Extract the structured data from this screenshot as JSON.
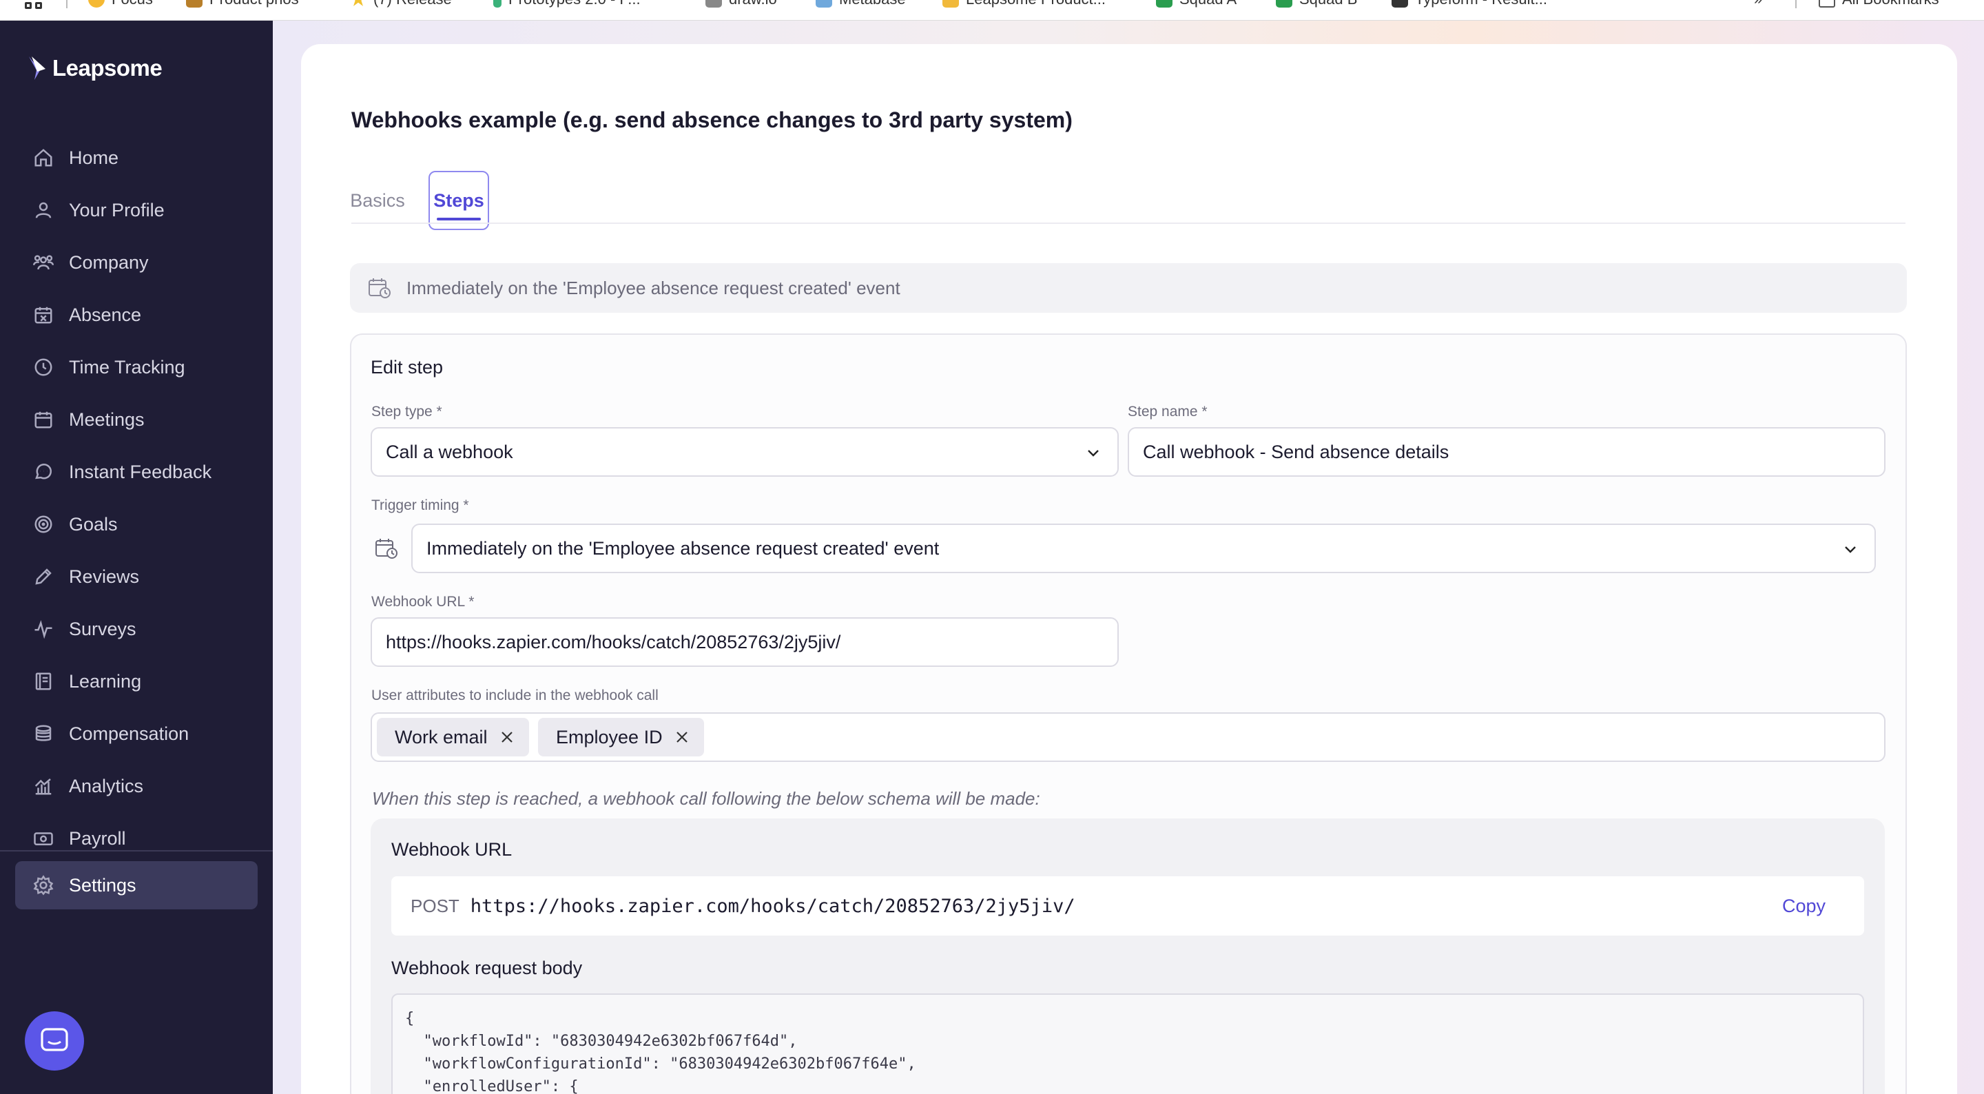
{
  "bookmarks": {
    "items": [
      {
        "label": "Focus",
        "color": "#f5b933"
      },
      {
        "label": "Product prios",
        "color": "#b87f2a"
      },
      {
        "label": "(7) Release",
        "color": "#f2c230"
      },
      {
        "label": "Prototypes 2.0 - P...",
        "color": "#3bb27a"
      },
      {
        "label": "draw.io",
        "color": "#888888"
      },
      {
        "label": "Metabase",
        "color": "#6fa8dc"
      },
      {
        "label": "Leapsome Product...",
        "color": "#f1b93b"
      },
      {
        "label": "Squad A",
        "color": "#2a9d4f"
      },
      {
        "label": "Squad B",
        "color": "#2a9d4f"
      },
      {
        "label": "Typeform - Result...",
        "color": "#333333"
      }
    ],
    "more": "»",
    "all_bookmarks": "All Bookmarks"
  },
  "sidebar": {
    "brand": "Leapsome",
    "items": [
      {
        "label": "Home",
        "icon": "home-icon"
      },
      {
        "label": "Your Profile",
        "icon": "user-icon"
      },
      {
        "label": "Company",
        "icon": "users-icon"
      },
      {
        "label": "Absence",
        "icon": "calendar-x-icon"
      },
      {
        "label": "Time Tracking",
        "icon": "clock-icon"
      },
      {
        "label": "Meetings",
        "icon": "calendar-icon"
      },
      {
        "label": "Instant Feedback",
        "icon": "chat-icon"
      },
      {
        "label": "Goals",
        "icon": "target-icon"
      },
      {
        "label": "Reviews",
        "icon": "pencil-icon"
      },
      {
        "label": "Surveys",
        "icon": "pulse-icon"
      },
      {
        "label": "Learning",
        "icon": "book-icon"
      },
      {
        "label": "Compensation",
        "icon": "coins-icon"
      },
      {
        "label": "Analytics",
        "icon": "bar-chart-icon"
      },
      {
        "label": "Payroll",
        "icon": "money-icon"
      }
    ],
    "settings": "Settings"
  },
  "page": {
    "title": "Webhooks example (e.g. send absence changes to 3rd party system)",
    "tabs": [
      {
        "label": "Basics",
        "active": false
      },
      {
        "label": "Steps",
        "active": true
      }
    ],
    "trigger_banner": "Immediately on the 'Employee absence request created' event"
  },
  "edit_step": {
    "heading": "Edit step",
    "step_type_label": "Step type *",
    "step_type_value": "Call a webhook",
    "step_name_label": "Step name *",
    "step_name_value": "Call webhook - Send absence details",
    "trigger_timing_label": "Trigger timing *",
    "trigger_timing_value": "Immediately on the 'Employee absence request created' event",
    "webhook_url_label": "Webhook URL *",
    "webhook_url_value": "https://hooks.zapier.com/hooks/catch/20852763/2jy5jiv/",
    "attributes_label": "User attributes to include in the webhook call",
    "attributes": [
      "Work email",
      "Employee ID"
    ]
  },
  "schema": {
    "note": "When this step is reached, a webhook call following the below schema will be made:",
    "url_heading": "Webhook URL",
    "method": "POST",
    "url": "https://hooks.zapier.com/hooks/catch/20852763/2jy5jiv/",
    "copy_label": "Copy",
    "body_heading": "Webhook request body",
    "body": "{\n  \"workflowId\": \"6830304942e6302bf067f64d\",\n  \"workflowConfigurationId\": \"6830304942e6302bf067f64e\",\n  \"enrolledUser\": {"
  }
}
